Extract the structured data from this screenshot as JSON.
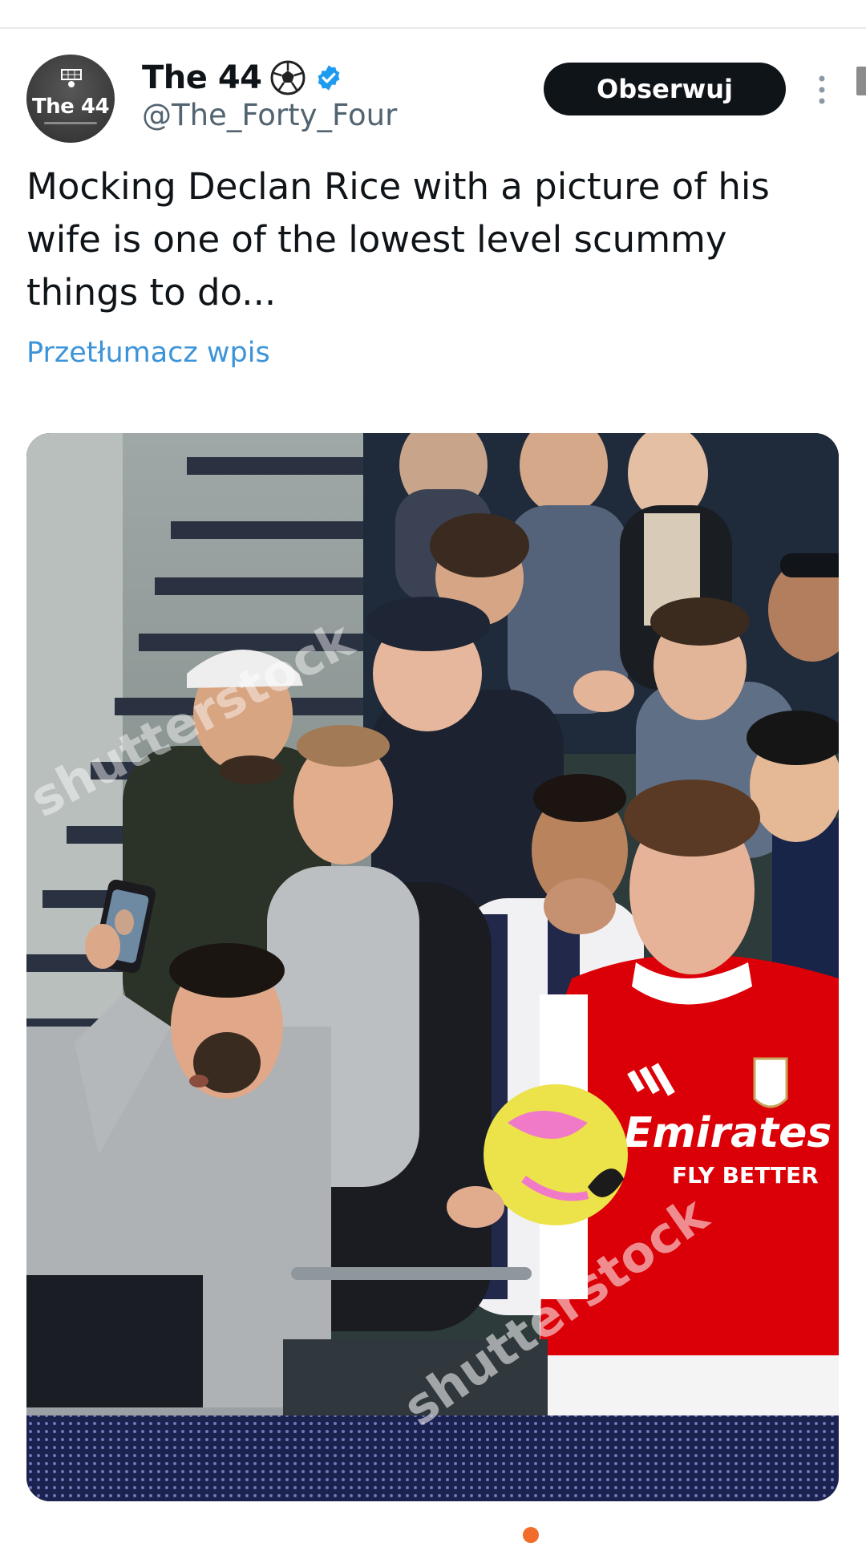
{
  "author": {
    "display_name": "The 44",
    "handle": "@The_Forty_Four",
    "avatar_text": "The 44",
    "badge_icon": "soccer-ball-icon",
    "verified_icon": "verified-badge-icon",
    "verified_color": "#1d9bf0"
  },
  "actions": {
    "follow_label": "Obserwuj",
    "more_icon": "more-vertical-icon"
  },
  "tweet": {
    "text": "Mocking Declan Rice with a picture of his wife is one of the lowest level scummy things to do...",
    "translate_label": "Przetłumacz wpis"
  },
  "media": {
    "watermark_1": "shutterstock",
    "watermark_2": "shutterstock",
    "shirt_sponsor": "Emirates",
    "shirt_slogan": "FLY BETTER"
  },
  "colors": {
    "follow_bg": "#0f1419",
    "link": "#1d9bf0",
    "arsenal_red": "#db0007"
  }
}
